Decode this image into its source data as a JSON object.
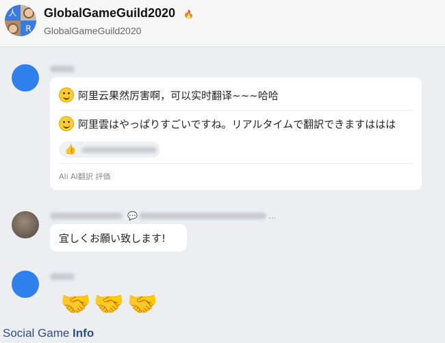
{
  "header": {
    "title": "GlobalGameGuild2020",
    "subtitle": "GlobalGameGuild2020",
    "flame_icon": "flame-icon",
    "avatar_letters": [
      "人",
      "R"
    ]
  },
  "messages": {
    "first": {
      "line_cn": "阿里云果然厉害啊，可以实时翻译~~~哈哈",
      "line_jp": "阿里雲はやっぱりすごいですね。リアルタイムで翻訳できますははは",
      "reaction_icon": "thumbs-up-icon",
      "ali_label": "Ali AI翻訳  評価"
    },
    "second": {
      "text": "宜しくお願い致します!",
      "ellipsis": "..."
    },
    "third": {
      "emoji": "🤝🤝🤝"
    }
  },
  "watermark": {
    "part1": "Social Game ",
    "part2": "Info"
  }
}
